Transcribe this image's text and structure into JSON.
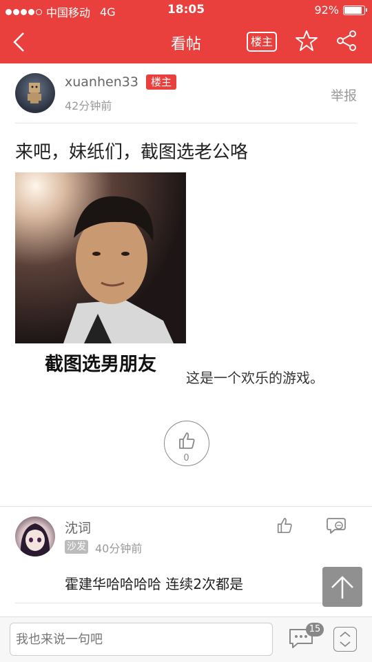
{
  "status": {
    "carrier": "中国移动",
    "network": "4G",
    "time": "18:05",
    "battery": "92%",
    "battery_level": 0.92
  },
  "nav": {
    "title": "看帖",
    "op_label": "楼主"
  },
  "post": {
    "username": "xuanhen33",
    "badge": "楼主",
    "time": "42分钟前",
    "report": "举报",
    "title": "来吧，妹纸们，截图选老公咯",
    "image_caption": "截图选男朋友",
    "text": "这是一个欢乐的游戏。",
    "like_count": "0"
  },
  "comments": [
    {
      "name": "沈词",
      "floor_badge": "沙发",
      "time": "40分钟前",
      "text": "霍建华哈哈哈哈 连续2次都是"
    }
  ],
  "bottom": {
    "input_placeholder": "我也来说一句吧",
    "comment_count": "15"
  },
  "colors": {
    "accent": "#e9403e"
  },
  "icons": [
    "back-arrow-icon",
    "star-icon",
    "share-icon",
    "thumbs-up-icon",
    "comment-icon",
    "arrow-up-icon",
    "expand-icon"
  ]
}
